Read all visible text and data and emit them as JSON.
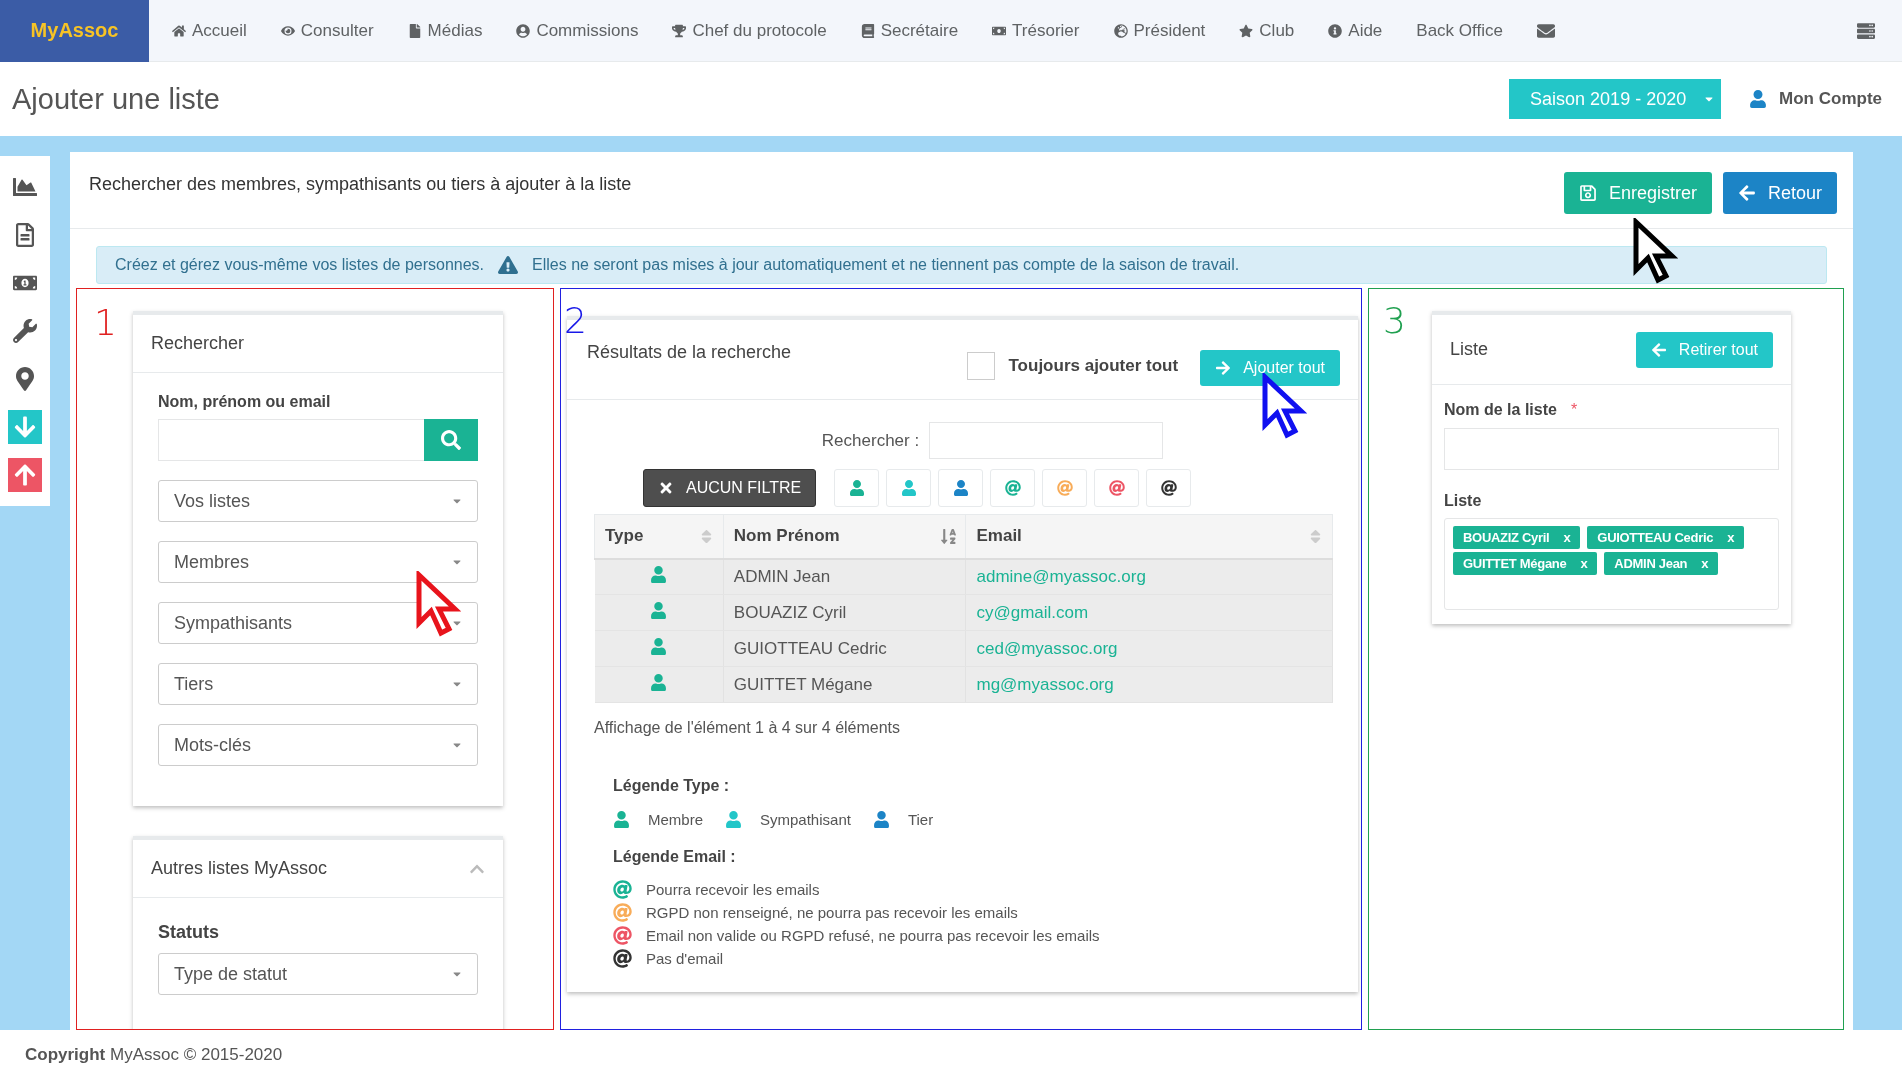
{
  "nav": {
    "brand": "MyAssoc",
    "items": [
      {
        "label": "Accueil"
      },
      {
        "label": "Consulter"
      },
      {
        "label": "Médias"
      },
      {
        "label": "Commissions"
      },
      {
        "label": "Chef du protocole"
      },
      {
        "label": "Secrétaire"
      },
      {
        "label": "Trésorier"
      },
      {
        "label": "Président"
      },
      {
        "label": "Club"
      },
      {
        "label": "Aide"
      },
      {
        "label": "Back Office"
      }
    ]
  },
  "page": {
    "title": "Ajouter une liste",
    "season": "Saison 2019 - 2020",
    "account": "Mon Compte"
  },
  "card": {
    "heading": "Rechercher des membres, sympathisants ou tiers à ajouter à la liste",
    "save": "Enregistrer",
    "back": "Retour",
    "info": "Créez et gérez vous-même vos listes de personnes.",
    "warning": "Elles ne seront pas mises à jour automatiquement et ne tiennent pas compte de la saison de travail."
  },
  "search": {
    "number": "1",
    "title": "Rechercher",
    "field_label": "Nom, prénom ou email",
    "selects": [
      "Vos listes",
      "Membres",
      "Sympathisants",
      "Tiers",
      "Mots-clés"
    ],
    "other": {
      "title": "Autres listes MyAssoc",
      "expanded": true,
      "label": "Statuts",
      "select": "Type de statut"
    }
  },
  "results": {
    "number": "2",
    "title": "Résultats de la recherche",
    "always_add_all": {
      "label": "Toujours ajouter tout",
      "checked": false
    },
    "add_all": "Ajouter tout",
    "search_label": "Rechercher :",
    "no_filter": "AUCUN FILTRE",
    "filters": [
      {
        "kind": "type",
        "color": "#1ab394"
      },
      {
        "kind": "type",
        "color": "#23c6c8"
      },
      {
        "kind": "type",
        "color": "#1c84c6"
      },
      {
        "kind": "email",
        "color": "#1ab394"
      },
      {
        "kind": "email",
        "color": "#f8ac59"
      },
      {
        "kind": "email",
        "color": "#ed5565"
      },
      {
        "kind": "email",
        "color": "#333333"
      }
    ],
    "columns": [
      {
        "label": "Type",
        "sorted": false
      },
      {
        "label": "Nom Prénom",
        "sorted": true
      },
      {
        "label": "Email",
        "sorted": false
      }
    ],
    "rows": [
      {
        "color": "#1ab394",
        "name": "ADMIN Jean",
        "email": "admine@myassoc.org"
      },
      {
        "color": "#1ab394",
        "name": "BOUAZIZ Cyril",
        "email": "cy@gmail.com"
      },
      {
        "color": "#1ab394",
        "name": "GUIOTTEAU Cedric",
        "email": "ced@myassoc.org"
      },
      {
        "color": "#1ab394",
        "name": "GUITTET Mégane",
        "email": "mg@myassoc.org"
      }
    ],
    "info": "Affichage de l'élément 1 à 4 sur 4 éléments",
    "legend_type": {
      "title": "Légende Type :",
      "items": [
        {
          "label": "Membre",
          "color": "#1ab394"
        },
        {
          "label": "Sympathisant",
          "color": "#23c6c8"
        },
        {
          "label": "Tier",
          "color": "#1c84c6"
        }
      ]
    },
    "legend_email": {
      "title": "Légende Email :",
      "items": [
        {
          "label": "Pourra recevoir les emails",
          "color": "#1ab394"
        },
        {
          "label": "RGPD non renseigné, ne pourra pas recevoir les emails",
          "color": "#f8ac59"
        },
        {
          "label": "Email non valide ou RGPD refusé, ne pourra pas recevoir les emails",
          "color": "#ed5565"
        },
        {
          "label": "Pas d'email",
          "color": "#333333"
        }
      ]
    }
  },
  "list": {
    "number": "3",
    "title": "Liste",
    "remove_all": "Retirer tout",
    "name_label": "Nom de la liste",
    "required": "*",
    "list_label": "Liste",
    "tags": [
      {
        "label": "BOUAZIZ Cyril",
        "remove": "x"
      },
      {
        "label": "GUIOTTEAU Cedric",
        "remove": "x"
      },
      {
        "label": "GUITTET Mégane",
        "remove": "x"
      },
      {
        "label": "ADMIN Jean",
        "remove": "x"
      }
    ]
  },
  "footer": "**Copyright** MyAssoc © 2015-2020"
}
